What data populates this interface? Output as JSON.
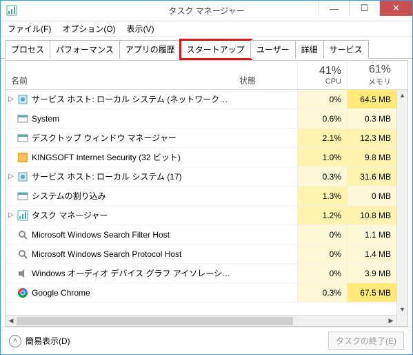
{
  "window": {
    "title": "タスク マネージャー"
  },
  "menu": {
    "file": "ファイル(F)",
    "options": "オプション(O)",
    "view": "表示(V)"
  },
  "tabs": {
    "processes": "プロセス",
    "performance": "パフォーマンス",
    "app_history": "アプリの履歴",
    "startup": "スタートアップ",
    "users": "ユーザー",
    "details": "詳細",
    "services": "サービス"
  },
  "columns": {
    "name": "名前",
    "status": "状態",
    "cpu_pct": "41%",
    "cpu_label": "CPU",
    "mem_pct": "61%",
    "mem_label": "メモリ"
  },
  "rows": [
    {
      "exp": true,
      "icon": "gear",
      "name": "サービス ホスト: ローカル システム (ネットワーク制限...",
      "cpu": "0%",
      "mem": "64.5 MB",
      "cpu_d": 0,
      "mem_d": 2
    },
    {
      "exp": false,
      "icon": "window",
      "name": "System",
      "cpu": "0.6%",
      "mem": "0.3 MB",
      "cpu_d": 0,
      "mem_d": 0
    },
    {
      "exp": false,
      "icon": "window",
      "name": "デスクトップ ウィンドウ マネージャー",
      "cpu": "2.1%",
      "mem": "12.3 MB",
      "cpu_d": 1,
      "mem_d": 1
    },
    {
      "exp": false,
      "icon": "king",
      "name": "KINGSOFT Internet Security (32 ビット)",
      "cpu": "1.0%",
      "mem": "9.8 MB",
      "cpu_d": 1,
      "mem_d": 1
    },
    {
      "exp": true,
      "icon": "gear",
      "name": "サービス ホスト: ローカル システム (17)",
      "cpu": "0.3%",
      "mem": "31.6 MB",
      "cpu_d": 0,
      "mem_d": 1
    },
    {
      "exp": false,
      "icon": "window",
      "name": "システムの割り込み",
      "cpu": "1.3%",
      "mem": "0 MB",
      "cpu_d": 1,
      "mem_d": 0
    },
    {
      "exp": true,
      "icon": "taskmgr",
      "name": "タスク マネージャー",
      "cpu": "1.2%",
      "mem": "10.8 MB",
      "cpu_d": 1,
      "mem_d": 1
    },
    {
      "exp": false,
      "icon": "search",
      "name": "Microsoft Windows Search Filter Host",
      "cpu": "0%",
      "mem": "1.1 MB",
      "cpu_d": 0,
      "mem_d": 0
    },
    {
      "exp": false,
      "icon": "search",
      "name": "Microsoft Windows Search Protocol Host",
      "cpu": "0%",
      "mem": "1.4 MB",
      "cpu_d": 0,
      "mem_d": 0
    },
    {
      "exp": false,
      "icon": "audio",
      "name": "Windows オーディオ デバイス グラフ アイソレーション",
      "cpu": "0%",
      "mem": "3.9 MB",
      "cpu_d": 0,
      "mem_d": 0
    },
    {
      "exp": false,
      "icon": "chrome",
      "name": "Google Chrome",
      "cpu": "0.3%",
      "mem": "67.5 MB",
      "cpu_d": 0,
      "mem_d": 2
    }
  ],
  "footer": {
    "fewer": "簡易表示(D)",
    "end_task": "タスクの終了(E)"
  },
  "highlight_tab": "startup"
}
